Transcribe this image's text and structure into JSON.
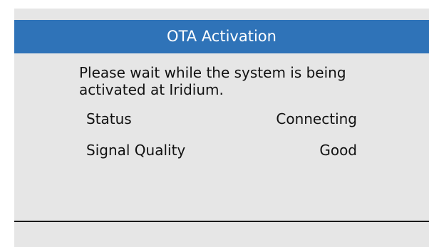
{
  "dialog": {
    "title": "OTA Activation",
    "message": "Please wait while the system is being activated at Iridium."
  },
  "status_rows": [
    {
      "label": "Status",
      "value": "Connecting"
    },
    {
      "label": "Signal Quality",
      "value": "Good"
    }
  ],
  "colors": {
    "title_bar": "#2f73b8",
    "background": "#e6e6e6",
    "text": "#111111"
  }
}
